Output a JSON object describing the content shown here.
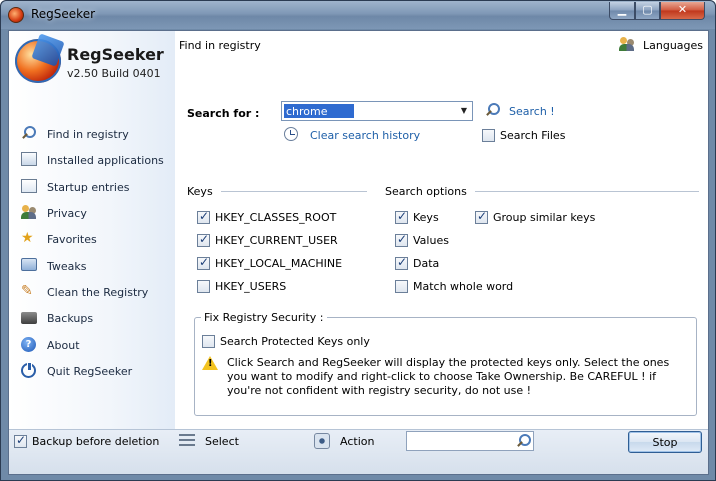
{
  "window": {
    "title": "RegSeeker"
  },
  "app": {
    "name": "RegSeeker",
    "version": "v2.50 Build 0401"
  },
  "sidebar": {
    "items": [
      {
        "label": "Find in registry",
        "icon": "search-icon"
      },
      {
        "label": "Installed applications",
        "icon": "applications-icon"
      },
      {
        "label": "Startup entries",
        "icon": "startup-icon"
      },
      {
        "label": "Privacy",
        "icon": "privacy-icon"
      },
      {
        "label": "Favorites",
        "icon": "star-icon"
      },
      {
        "label": "Tweaks",
        "icon": "tweaks-icon"
      },
      {
        "label": "Clean the Registry",
        "icon": "clean-icon"
      },
      {
        "label": "Backups",
        "icon": "backup-icon"
      },
      {
        "label": "About",
        "icon": "about-icon"
      },
      {
        "label": "Quit RegSeeker",
        "icon": "quit-icon"
      }
    ]
  },
  "main": {
    "section_title": "Find in registry",
    "languages_label": "Languages",
    "search": {
      "label": "Search for :",
      "value": "chrome",
      "button_label": "Search !",
      "clear_history_label": "Clear search history",
      "search_files_label": "Search Files",
      "search_files_checked": false
    },
    "keys": {
      "heading": "Keys",
      "items": [
        {
          "label": "HKEY_CLASSES_ROOT",
          "checked": true
        },
        {
          "label": "HKEY_CURRENT_USER",
          "checked": true
        },
        {
          "label": "HKEY_LOCAL_MACHINE",
          "checked": true
        },
        {
          "label": "HKEY_USERS",
          "checked": false
        }
      ]
    },
    "search_options": {
      "heading": "Search options",
      "items": [
        {
          "label": "Keys",
          "checked": true
        },
        {
          "label": "Values",
          "checked": true
        },
        {
          "label": "Data",
          "checked": true
        },
        {
          "label": "Match whole word",
          "checked": false
        }
      ],
      "group_similar": {
        "label": "Group similar keys",
        "checked": true
      }
    },
    "fix_security": {
      "legend": "Fix Registry Security :",
      "checkbox_label": "Search Protected Keys only",
      "checked": false,
      "warning": "Click Search and RegSeeker will display the protected keys only. Select the ones you want to modify and right-click to choose Take Ownership. Be CAREFUL ! if you're not confident with registry security, do not use !"
    }
  },
  "bottom": {
    "backup_label": "Backup before deletion",
    "backup_checked": true,
    "select_label": "Select",
    "action_label": "Action",
    "filter_value": "",
    "stop_label": "Stop"
  },
  "colors": {
    "accent": "#1e5fa8",
    "titlebar": "#7f98b6",
    "close": "#c0361b",
    "selection": "#2f6bd0"
  }
}
